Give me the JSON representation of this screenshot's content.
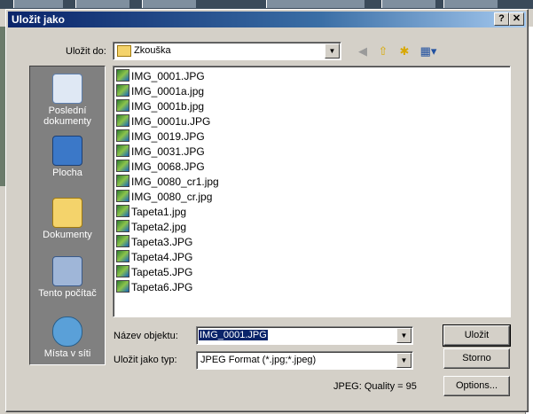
{
  "window": {
    "title": "Uložit jako",
    "help_label": "?",
    "close_label": "✕"
  },
  "save_in": {
    "label": "Uložit do:",
    "value": "Zkouška"
  },
  "toolbar": {
    "back_icon": "back-arrow-icon",
    "up_icon": "up-folder-icon",
    "new_folder_icon": "new-folder-icon",
    "views_icon": "views-menu-icon"
  },
  "places": [
    {
      "label": "Poslední dokumenty",
      "icon": "recent-documents-icon"
    },
    {
      "label": "Plocha",
      "icon": "desktop-icon"
    },
    {
      "label": "Dokumenty",
      "icon": "documents-folder-icon"
    },
    {
      "label": "Tento počítač",
      "icon": "my-computer-icon"
    },
    {
      "label": "Místa v síti",
      "icon": "network-places-icon"
    }
  ],
  "files": [
    "IMG_0001.JPG",
    "IMG_0001a.jpg",
    "IMG_0001b.jpg",
    "IMG_0001u.JPG",
    "IMG_0019.JPG",
    "IMG_0031.JPG",
    "IMG_0068.JPG",
    "IMG_0080_cr1.jpg",
    "IMG_0080_cr.jpg",
    "Tapeta1.jpg",
    "Tapeta2.jpg",
    "Tapeta3.JPG",
    "Tapeta4.JPG",
    "Tapeta5.JPG",
    "Tapeta6.JPG"
  ],
  "filename": {
    "label": "Název objektu:",
    "value": "IMG_0001.JPG"
  },
  "filetype": {
    "label": "Uložit jako typ:",
    "value": "JPEG Format (*.jpg;*.jpeg)"
  },
  "quality_text": "JPEG: Quality = 95",
  "buttons": {
    "save": "Uložit",
    "cancel": "Storno",
    "options": "Options..."
  },
  "colors": {
    "title_start": "#0a246a",
    "title_end": "#a6caf0",
    "face": "#d4d0c8",
    "places_bg": "#808080"
  }
}
